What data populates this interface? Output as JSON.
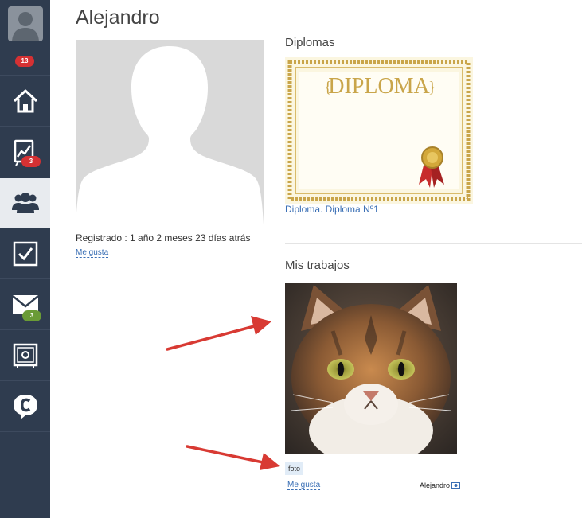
{
  "sidebar": {
    "profile_badge": "13",
    "analytics_badge": "3",
    "messages_badge": "3"
  },
  "profile": {
    "name": "Alejandro",
    "registered": "Registrado : 1 año 2 meses 23 días atrás",
    "like_label": "Me gusta"
  },
  "diplomas": {
    "title": "Diplomas",
    "diploma_word": "DIPLOMA",
    "link": "Diploma. Diploma Nº1"
  },
  "works": {
    "title": "Mis trabajos",
    "tag": "foto",
    "like_label": "Me gusta",
    "author": "Alejandro"
  },
  "colors": {
    "sidebar_bg": "#2f3c4f",
    "active_item_bg": "#e8ebef",
    "badge_red": "#d53133",
    "badge_green": "#6a9b36",
    "link_blue": "#3a6fb5",
    "arrow_red": "#d83a33"
  }
}
